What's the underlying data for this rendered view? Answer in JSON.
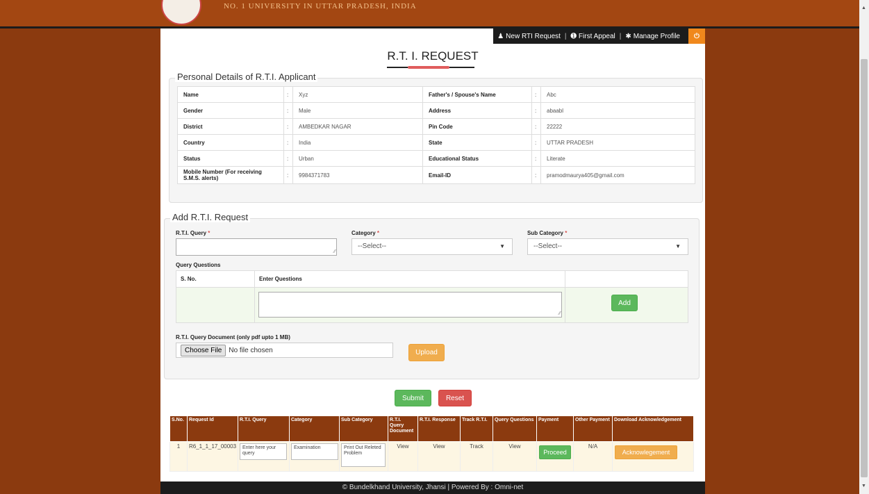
{
  "header": {
    "university_text": "NO. 1 UNIVERSITY IN UTTAR PRADESH, INDIA"
  },
  "nav": {
    "new_rti": "New RTI Request",
    "first_appeal": "First Appeal",
    "manage_profile": "Manage Profile",
    "separator": "|"
  },
  "page_title": "R.T. I. REQUEST",
  "personal": {
    "legend": "Personal Details of R.T.I. Applicant",
    "colon": ":",
    "rows": [
      {
        "l1": "Name",
        "v1": "Xyz",
        "l2": "Father's / Spouse's Name",
        "v2": "Abc"
      },
      {
        "l1": "Gender",
        "v1": "Male",
        "l2": "Address",
        "v2": "abaabl"
      },
      {
        "l1": "District",
        "v1": "AMBEDKAR NAGAR",
        "l2": "Pin Code",
        "v2": "22222"
      },
      {
        "l1": "Country",
        "v1": "India",
        "l2": "State",
        "v2": "UTTAR PRADESH"
      },
      {
        "l1": "Status",
        "v1": "Urban",
        "l2": "Educational Status",
        "v2": "Literate"
      },
      {
        "l1": "Mobile Number (For receiving S.M.S. alerts)",
        "v1": "9984371783",
        "l2": "Email-ID",
        "v2": "pramodmaurya405@gmail.com"
      }
    ]
  },
  "add": {
    "legend": "Add R.T.I. Request",
    "query_label": "R.T.I. Query",
    "category_label": "Category",
    "subcategory_label": "Sub Category",
    "required_mark": "*",
    "category_value": "--Select--",
    "subcategory_value": "--Select--",
    "query_questions_label": "Query Questions",
    "col_sno": "S. No.",
    "col_enter": "Enter Questions",
    "add_btn": "Add",
    "doc_label": "R.T.I. Query Document (only pdf upto 1 MB)",
    "choose_file": "Choose File",
    "no_file": "No file chosen",
    "upload_btn": "Upload"
  },
  "actions": {
    "submit": "Submit",
    "reset": "Reset"
  },
  "results": {
    "headers": [
      "S.No.",
      "Request Id",
      "R.T.I. Query",
      "Category",
      "Sub Category",
      "R.T.I. Query Document",
      "R.T.I. Response",
      "Track R.T.I.",
      "Query Questions",
      "Payment",
      "Other Payment",
      "Download Acknowledgement"
    ],
    "row": {
      "sno": "1",
      "request_id": "R6_1_1_17_00003",
      "query": "Enter here your query",
      "category": "Examination",
      "subcategory": "Print Out Releted Problem",
      "doc": "View",
      "response": "View",
      "track": "Track",
      "questions": "View",
      "payment": "Proceed",
      "other_payment": "N/A",
      "ack": "Acknowlegement"
    }
  },
  "footer": "© Bundelkhand University, Jhansi | Powered By : Omni-net"
}
